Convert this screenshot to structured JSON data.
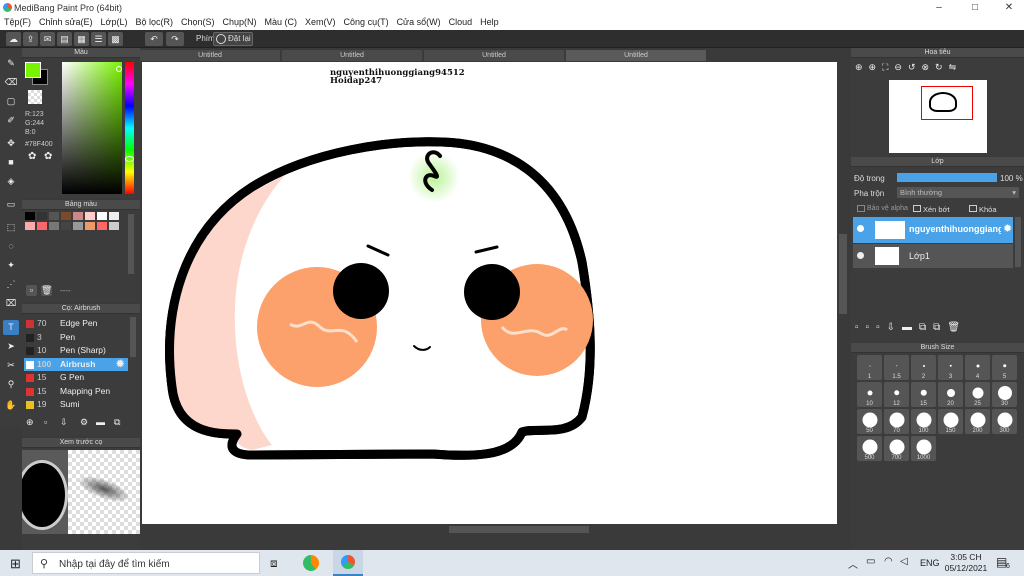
{
  "window": {
    "title": "MediBang Paint Pro (64bit)",
    "controls": [
      "–",
      "□",
      "✕"
    ]
  },
  "menu": [
    "Tệp(F)",
    "Chỉnh sửa(E)",
    "Lớp(L)",
    "Bộ lọc(R)",
    "Chọn(S)",
    "Chụp(N)",
    "Màu (C)",
    "Xem(V)",
    "Công cụ(T)",
    "Cửa sổ(W)",
    "Cloud",
    "Help"
  ],
  "toolbar": {
    "shortcut_label": "Phím",
    "reset_label": "Đặt lại"
  },
  "color_panel": {
    "title": "Màu",
    "rgb": {
      "r": "R:123",
      "g": "G:244",
      "b": "B:0"
    },
    "hex": "#78F400",
    "foreground": "#78f400",
    "swatch_title": "Bảng màu",
    "swatch_footer": "----",
    "swatches": [
      "#000000",
      "#333333",
      "#555555",
      "#7a4a2a",
      "#c88",
      "#ffcccc",
      "#fff",
      "#eee",
      "#ffaaaa",
      "#f66",
      "#777",
      "#444",
      "#999",
      "#e96",
      "#f66",
      "#ccc"
    ]
  },
  "brush_panel": {
    "title": "Cọ: Airbrush",
    "items": [
      {
        "size": "70",
        "name": "Edge Pen",
        "color": "#cc3333"
      },
      {
        "size": "3",
        "name": "Pen",
        "color": "#222222"
      },
      {
        "size": "10",
        "name": "Pen (Sharp)",
        "color": "#222222"
      },
      {
        "size": "100",
        "name": "Airbrush",
        "color": "#ffffff"
      },
      {
        "size": "15",
        "name": "G Pen",
        "color": "#dd3333"
      },
      {
        "size": "15",
        "name": "Mapping Pen",
        "color": "#dd3333"
      },
      {
        "size": "19",
        "name": "Sumi",
        "color": "#e8c020"
      }
    ],
    "selected_index": 3
  },
  "preview_panel": {
    "title": "Xem trước cọ"
  },
  "tabs": [
    "Untitled",
    "Untitled",
    "Untitled",
    "Untitled"
  ],
  "canvas": {
    "text_line1": "nguyenthihuonggiang94512",
    "text_line2": "Hoidap247"
  },
  "navigator": {
    "title": "Hoa tiêu"
  },
  "layers": {
    "title": "Lớp",
    "opacity_label": "Độ trong",
    "opacity_value": "100 %",
    "blend_label": "Pha trộn",
    "blend_value": "Bình thường",
    "protect_alpha": "Bảo vệ alpha",
    "clipping": "Xén bớt",
    "lock": "Khóa",
    "items": [
      {
        "name": "nguyenthihuonggiang",
        "selected": true
      },
      {
        "name": "Lớp1",
        "selected": false
      }
    ]
  },
  "brush_size": {
    "title": "Brush Size",
    "sizes": [
      "1",
      "1.5",
      "2",
      "3",
      "4",
      "5",
      "10",
      "12",
      "15",
      "20",
      "25",
      "30",
      "50",
      "70",
      "100",
      "150",
      "200",
      "300",
      "500",
      "700",
      "1000"
    ]
  },
  "taskbar": {
    "search_placeholder": "Nhập tại đây để tìm kiếm",
    "lang": "ENG",
    "time": "3:05 CH",
    "date": "05/12/2021",
    "notification_count": "6"
  }
}
